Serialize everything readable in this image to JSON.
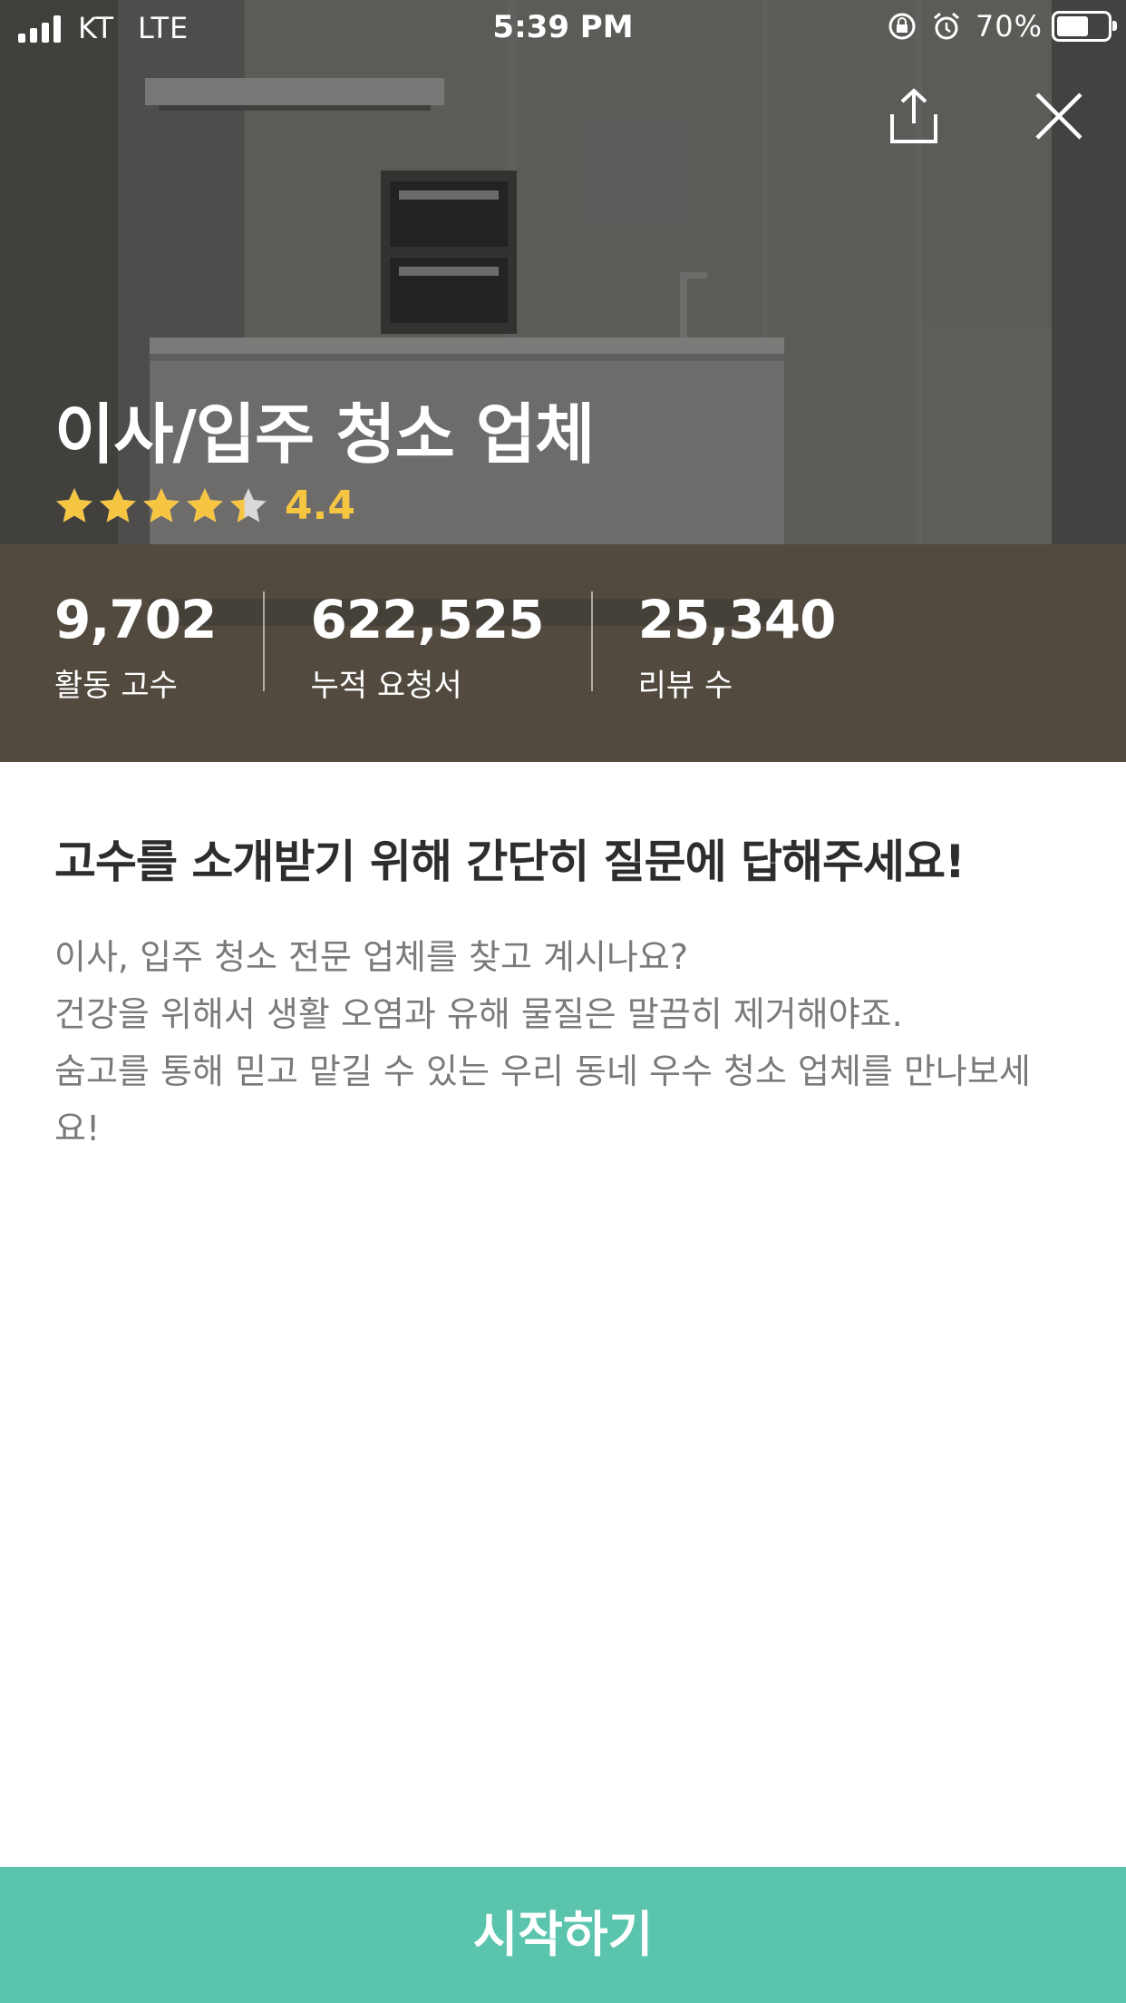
{
  "status_bar": {
    "carrier": "KT",
    "network": "LTE",
    "time": "5:39 PM",
    "battery": "70%",
    "battery_level": 0.7
  },
  "header": {
    "share_icon": "share-icon",
    "close_icon": "close-icon"
  },
  "hero": {
    "title": "이사/입주 청소 업체",
    "rating_value": "4.4",
    "rating": 4.4,
    "rating_max": 5,
    "star_color": "#f6c643",
    "stats": [
      {
        "value": "9,702",
        "label": "활동 고수"
      },
      {
        "value": "622,525",
        "label": "누적 요청서"
      },
      {
        "value": "25,340",
        "label": "리뷰 수"
      }
    ]
  },
  "main": {
    "heading": "고수를 소개받기 위해 간단히 질문에 답해주세요!",
    "description_lines": [
      "이사, 입주 청소 전문 업체를 찾고 계시나요?",
      "건강을 위해서 생활 오염과 유해 물질은 말끔히 제거해야죠.",
      "숨고를 통해 믿고 맡길 수 있는 우리 동네 우수 청소 업체를 만나보세",
      "요!"
    ]
  },
  "footer": {
    "start_label": "시작하기",
    "accent_color": "#5bc4ad"
  }
}
